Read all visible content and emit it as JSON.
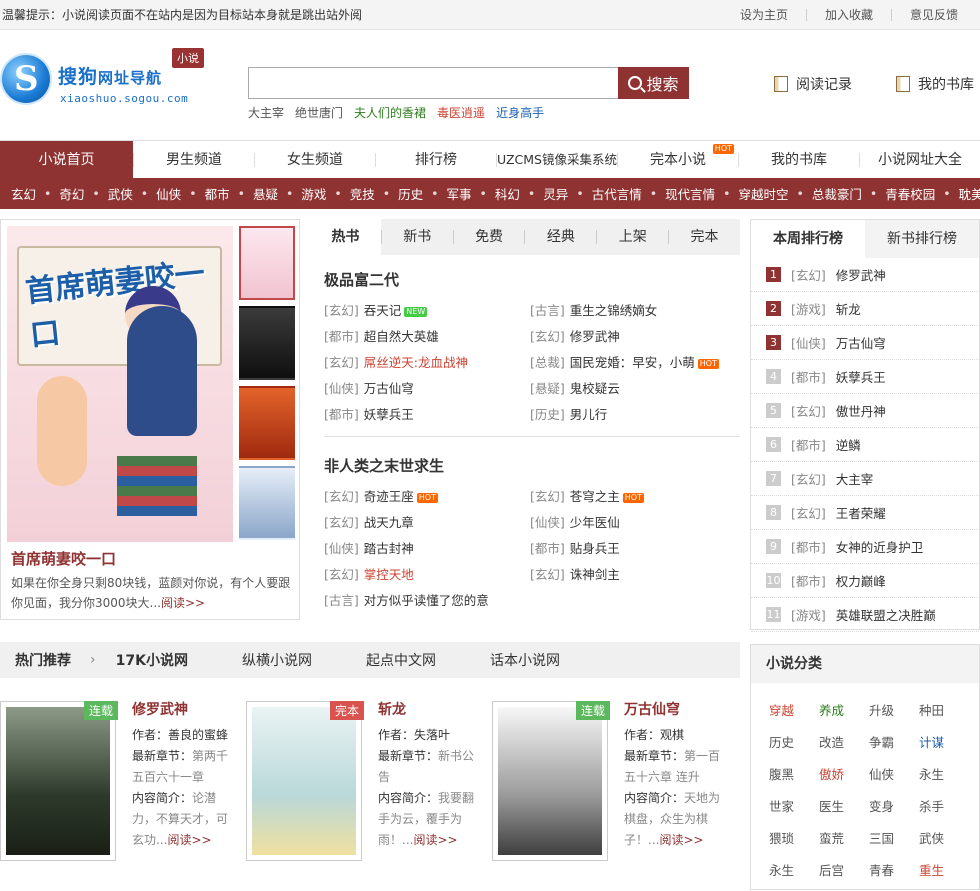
{
  "topbar": {
    "notice": "温馨提示：小说阅读页面不在站内是因为目标站本身就是跳出站外阅",
    "links": [
      "设为主页",
      "加入收藏",
      "意见反馈"
    ]
  },
  "logo": {
    "name": "搜狗",
    "name_suffix": "网址导航",
    "domain": "xiaoshuo.sogou.com",
    "tag": "小说"
  },
  "search": {
    "value": "",
    "button": "搜索",
    "hotwords": [
      "大主宰",
      "绝世唐门",
      "夫人们的香裙",
      "毒医逍遥",
      "近身高手"
    ]
  },
  "head_links": [
    "阅读记录",
    "我的书库"
  ],
  "nav": {
    "items": [
      "小说首页",
      "男生频道",
      "女生频道",
      "排行榜",
      "UZCMS镜像采集系统",
      "完本小说",
      "我的书库",
      "小说网址大全"
    ],
    "hot_badge": "HOT"
  },
  "subnav": [
    "玄幻",
    "奇幻",
    "武侠",
    "仙侠",
    "都市",
    "悬疑",
    "游戏",
    "竞技",
    "历史",
    "军事",
    "科幻",
    "灵异",
    "古代言情",
    "现代言情",
    "穿越时空",
    "总裁豪门",
    "青春校园",
    "耽美同人"
  ],
  "focus": {
    "cover_title": "首席萌妻咬一口",
    "title": "首席萌妻咬一口",
    "desc": "如果在你全身只剩80块钱，蓝颜对你说，有个人要跟你见面，我分你3000块大...",
    "more": "阅读>>"
  },
  "mid_tabs": [
    "热书",
    "新书",
    "免费",
    "经典",
    "上架",
    "完本"
  ],
  "blocks": [
    {
      "title": "极品富二代",
      "items": [
        {
          "cat": "[玄幻]",
          "name": "吞天记",
          "badge": "NEW"
        },
        {
          "cat": "[古言]",
          "name": "重生之锦绣嫡女"
        },
        {
          "cat": "[都市]",
          "name": "超自然大英雄"
        },
        {
          "cat": "[玄幻]",
          "name": "修罗武神"
        },
        {
          "cat": "[玄幻]",
          "name": "屌丝逆天:龙血战神",
          "red": true
        },
        {
          "cat": "[总裁]",
          "name": "国民宠婚：早安，小萌",
          "badge": "HOT"
        },
        {
          "cat": "[仙侠]",
          "name": "万古仙穹"
        },
        {
          "cat": "[悬疑]",
          "name": "鬼校疑云"
        },
        {
          "cat": "[都市]",
          "name": "妖孽兵王"
        },
        {
          "cat": "[历史]",
          "name": "男儿行"
        }
      ]
    },
    {
      "title": "非人类之末世求生",
      "items": [
        {
          "cat": "[玄幻]",
          "name": "奇迹王座",
          "badge": "HOT"
        },
        {
          "cat": "[玄幻]",
          "name": "苍穹之主",
          "badge": "HOT"
        },
        {
          "cat": "[玄幻]",
          "name": "战天九章"
        },
        {
          "cat": "[仙侠]",
          "name": "少年医仙"
        },
        {
          "cat": "[仙侠]",
          "name": "踏古封神"
        },
        {
          "cat": "[都市]",
          "name": "贴身兵王"
        },
        {
          "cat": "[玄幻]",
          "name": "掌控天地",
          "red": true
        },
        {
          "cat": "[玄幻]",
          "name": "诛神剑主"
        },
        {
          "cat": "[古言]",
          "name": "对方似乎读懂了您的意"
        }
      ]
    }
  ],
  "rank": {
    "tabs": [
      "本周排行榜",
      "新书排行榜"
    ],
    "items": [
      {
        "n": "1",
        "cat": "[玄幻]",
        "name": "修罗武神"
      },
      {
        "n": "2",
        "cat": "[游戏]",
        "name": "斩龙"
      },
      {
        "n": "3",
        "cat": "[仙侠]",
        "name": "万古仙穹"
      },
      {
        "n": "4",
        "cat": "[都市]",
        "name": "妖孽兵王"
      },
      {
        "n": "5",
        "cat": "[玄幻]",
        "name": "傲世丹神"
      },
      {
        "n": "6",
        "cat": "[都市]",
        "name": "逆鳞"
      },
      {
        "n": "7",
        "cat": "[玄幻]",
        "name": "大主宰"
      },
      {
        "n": "8",
        "cat": "[玄幻]",
        "name": "王者荣耀"
      },
      {
        "n": "9",
        "cat": "[都市]",
        "name": "女神的近身护卫"
      },
      {
        "n": "10",
        "cat": "[都市]",
        "name": "权力巅峰"
      },
      {
        "n": "11",
        "cat": "[游戏]",
        "name": "英雄联盟之决胜巅"
      }
    ]
  },
  "hotbar": {
    "title": "热门推荐",
    "arrow": "›",
    "sites": [
      "17K小说网",
      "纵横小说网",
      "起点中文网",
      "话本小说网"
    ]
  },
  "cards": [
    {
      "tag": "连载",
      "title": "修罗武神",
      "author_label": "作者：",
      "author": "善良的蜜蜂",
      "chapter_label": "最新章节：",
      "chapter": "第两千五百六十一章",
      "intro_label": "内容简介：",
      "intro": "论潜力，不算天才，可玄功...",
      "more": "阅读>>"
    },
    {
      "tag": "完本",
      "title": "斩龙",
      "author_label": "作者：",
      "author": "失落叶",
      "chapter_label": "最新章节：",
      "chapter": "新书公告",
      "intro_label": "内容简介：",
      "intro": "我要翻手为云，覆手为雨！...",
      "more": "阅读>>"
    },
    {
      "tag": "连载",
      "title": "万古仙穹",
      "author_label": "作者：",
      "author": "观棋",
      "chapter_label": "最新章节：",
      "chapter": "第一百五十六章 连升",
      "intro_label": "内容简介：",
      "intro": "天地为棋盘，众生为棋子！...",
      "more": "阅读>>"
    }
  ],
  "categories": {
    "title": "小说分类",
    "items": [
      {
        "t": "穿越",
        "c": "red"
      },
      {
        "t": "养成",
        "c": "green"
      },
      {
        "t": "升级"
      },
      {
        "t": "种田"
      },
      {
        "t": "历史"
      },
      {
        "t": "改造"
      },
      {
        "t": "争霸"
      },
      {
        "t": "计谋",
        "c": "blue"
      },
      {
        "t": "腹黑"
      },
      {
        "t": "傲娇",
        "c": "red"
      },
      {
        "t": "仙侠"
      },
      {
        "t": "永生"
      },
      {
        "t": "世家"
      },
      {
        "t": "医生"
      },
      {
        "t": "变身"
      },
      {
        "t": "杀手"
      },
      {
        "t": "猥琐"
      },
      {
        "t": "蛮荒"
      },
      {
        "t": "三国"
      },
      {
        "t": "武侠"
      },
      {
        "t": "永生"
      },
      {
        "t": "后宫"
      },
      {
        "t": "青春"
      },
      {
        "t": "重生",
        "c": "red"
      }
    ]
  },
  "colors": {
    "brand": "#8f3232",
    "hot": "#ff6600",
    "new": "#44cc44"
  }
}
